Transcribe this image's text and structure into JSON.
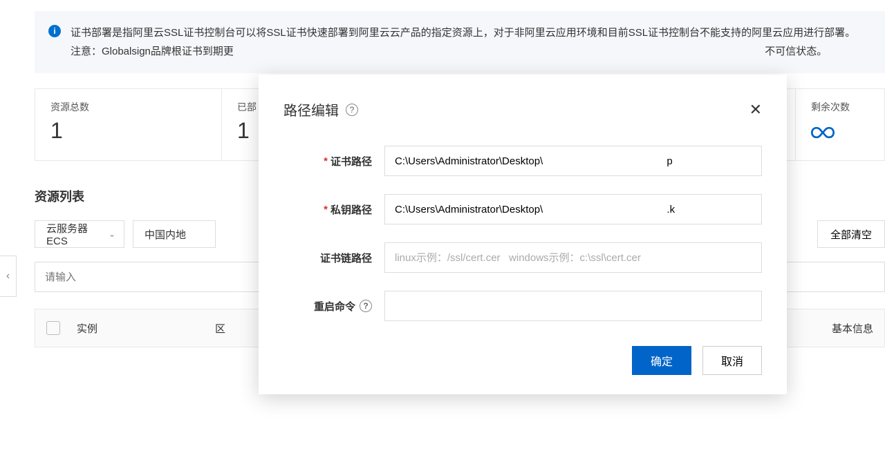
{
  "banner": {
    "line1": "证书部署是指阿里云SSL证书控制台可以将SSL证书快速部署到阿里云云产品的指定资源上，对于非阿里云应用环境和目前SSL证书控制台不能支持的阿里云应用进行部署。",
    "line2_prefix": "注意：Globalsign品牌根证书到期更",
    "line2_suffix": "不可信状态。"
  },
  "stats": {
    "total_label": "资源总数",
    "total_value": "1",
    "deployed_label": "已部",
    "deployed_value": "1",
    "remaining_label": "剩余次数"
  },
  "section": {
    "title": "资源列表",
    "select_product": "云服务器ECS",
    "select_region": "中国内地",
    "clear_all": "全部清空",
    "search_placeholder": "请输入",
    "col_instance": "实例",
    "col_region": "区",
    "col_actions": "基本信息"
  },
  "modal": {
    "title": "路径编辑",
    "cert_label": "证书路径",
    "cert_value": "C:\\Users\\Administrator\\Desktop\\                                           p",
    "key_label": "私钥路径",
    "key_value": "C:\\Users\\Administrator\\Desktop\\                                           .k",
    "chain_label": "证书链路径",
    "chain_placeholder": "linux示例：/ssl/cert.cer   windows示例：c:\\ssl\\cert.cer",
    "restart_label": "重启命令",
    "ok": "确定",
    "cancel": "取消"
  }
}
